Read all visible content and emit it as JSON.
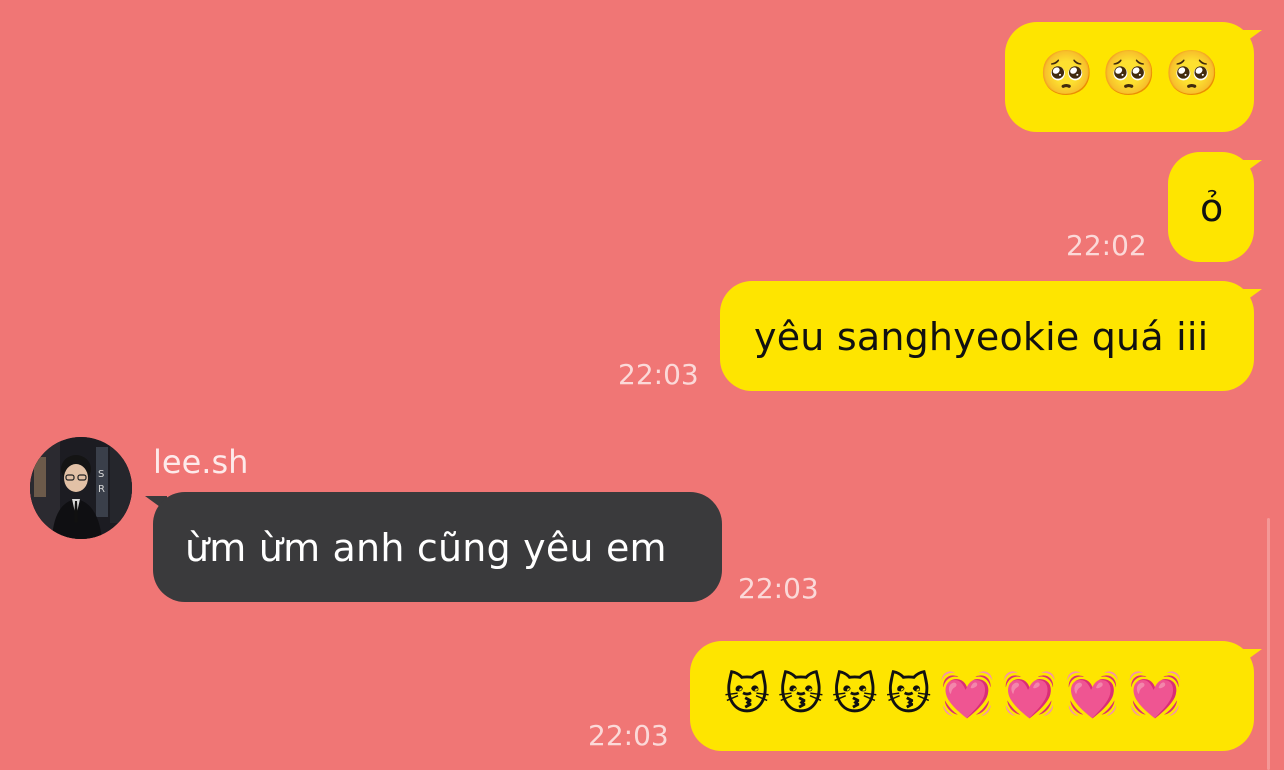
{
  "chat": {
    "background_color": "#f07675",
    "outgoing_bubble_color": "#fee500",
    "incoming_bubble_color": "#3a3a3c"
  },
  "messages": [
    {
      "direction": "out",
      "text": "🥺🥺🥺",
      "time": ""
    },
    {
      "direction": "out",
      "text": "ỏ",
      "time": "22:02"
    },
    {
      "direction": "out",
      "text": "yêu sanghyeokie quá iii",
      "time": "22:03"
    },
    {
      "direction": "in",
      "sender": "lee.sh",
      "text": "ừm ừm anh cũng yêu em",
      "time": "22:03"
    },
    {
      "direction": "out",
      "text": "😽😽😽😽💓💓💓💓",
      "time": "22:03"
    }
  ]
}
